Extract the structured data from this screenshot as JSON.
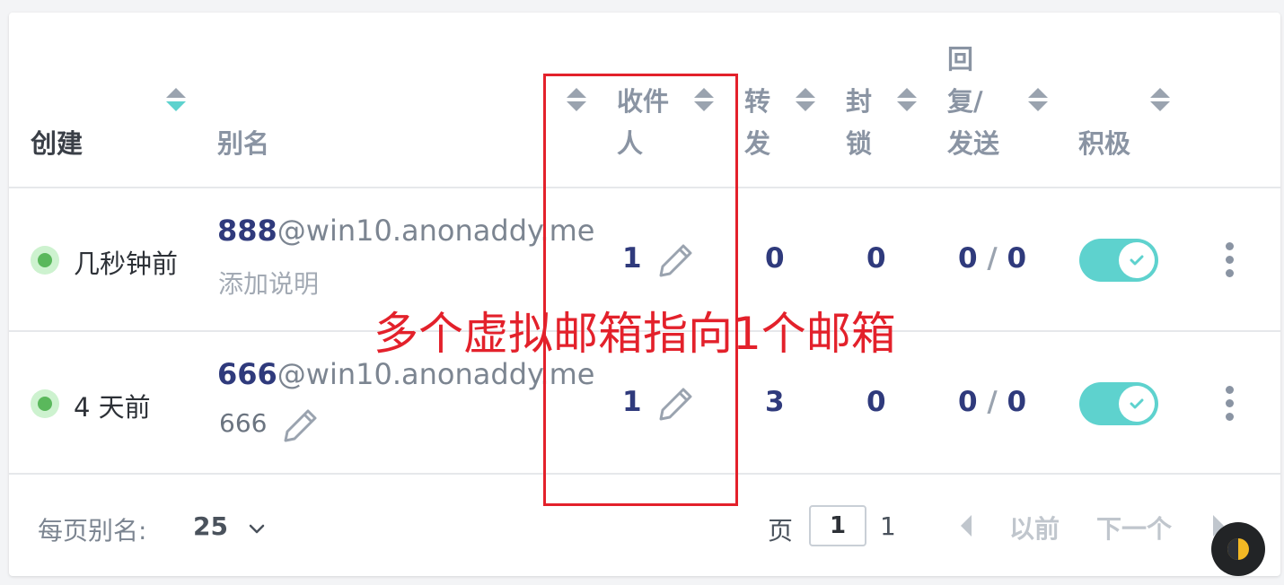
{
  "table": {
    "headers": {
      "created": "创建",
      "alias": "别名",
      "recipients_line1": "收件",
      "recipients_line2": "人",
      "forwarded_line1": "转",
      "forwarded_line2": "发",
      "blocked_line1": "封",
      "blocked_line2": "锁",
      "replies_line1": "回",
      "replies_line2": "复/",
      "replies_line3": "发送",
      "active": "积极"
    },
    "rows": [
      {
        "created": "几秒钟前",
        "alias_local": "888",
        "alias_domain": "@win10.anonaddy.me",
        "description": "添加说明",
        "recipients": "1",
        "forwarded": "0",
        "blocked": "0",
        "replies": "0",
        "sent": "0",
        "active": true
      },
      {
        "created": "4 天前",
        "alias_local": "666",
        "alias_domain": "@win10.anonaddy.me",
        "description": "666",
        "recipients": "1",
        "forwarded": "3",
        "blocked": "0",
        "replies": "0",
        "sent": "0",
        "active": true
      }
    ],
    "reply_separator": "/"
  },
  "footer": {
    "per_page_label": "每页别名:",
    "per_page_value": "25",
    "page_label": "页",
    "current_page": "1",
    "total_pages": "1",
    "prev_label": "以前",
    "next_label": "下一个"
  },
  "annotation": {
    "text": "多个虚拟邮箱指向1个邮箱",
    "color": "#e3212b"
  },
  "colors": {
    "accent": "#5ed2ce",
    "alias_blue": "#2f3a7c",
    "status_green": "#5ab85c"
  },
  "icons": [
    "sort-icon",
    "pencil-icon",
    "check-icon",
    "kebab-icon",
    "chevron-down-icon",
    "chevron-left-icon",
    "chevron-right-icon",
    "theme-icon"
  ]
}
